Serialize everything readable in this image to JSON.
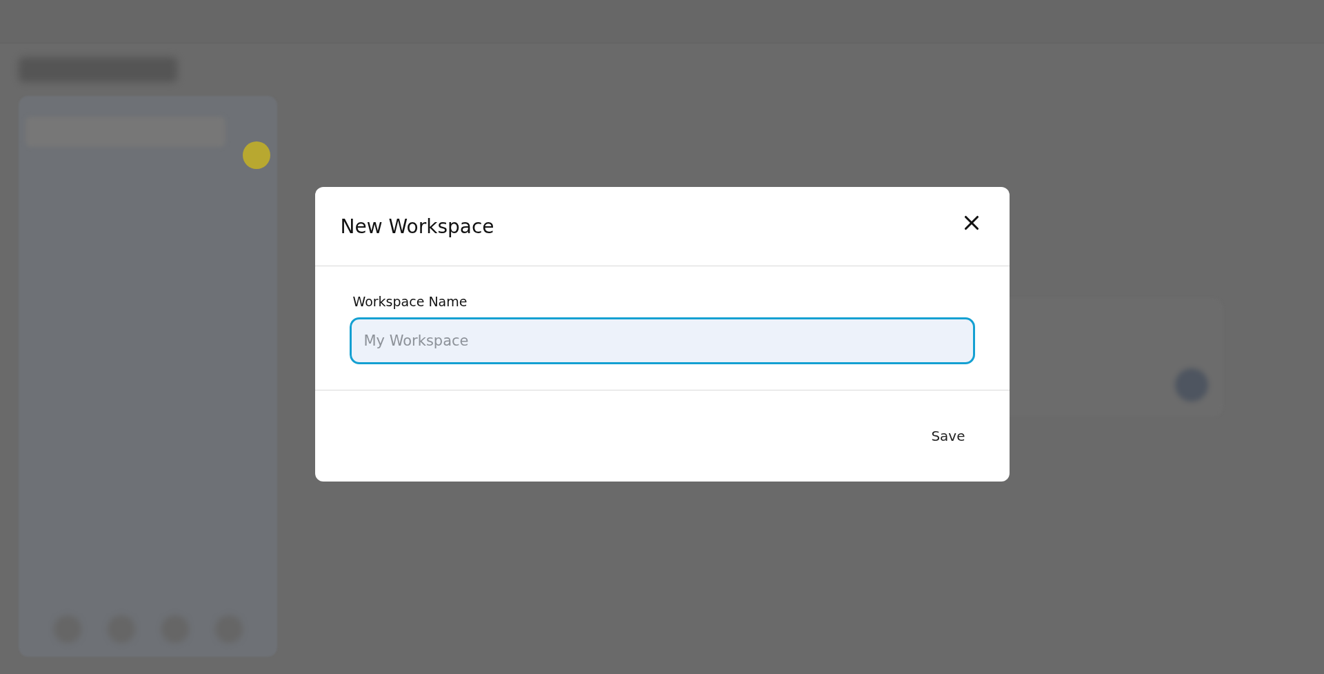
{
  "dialog": {
    "title": "New Workspace",
    "field": {
      "label": "Workspace Name",
      "placeholder": "My Workspace",
      "focused": true
    },
    "buttons": [
      "Save"
    ]
  }
}
